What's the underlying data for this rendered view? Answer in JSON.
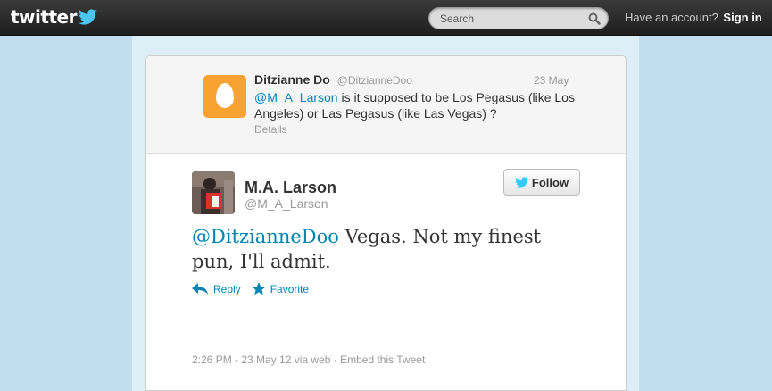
{
  "topbar": {
    "logo_text": "twitter",
    "logo_icon": "twitter-bird-icon",
    "search_placeholder": "Search",
    "account_prompt": "Have an account?",
    "signin_label": "Sign in"
  },
  "parent_tweet": {
    "author_name": "Ditzianne Do",
    "author_handle": "@DitzianneDoo",
    "date": "23 May",
    "mention": "@M_A_Larson",
    "text": " is it supposed to be Los Pegasus (like Los Angeles) or Las Pegasus (like Las Vegas) ?",
    "details_label": "Details",
    "avatar_color": "#f8a232"
  },
  "main_tweet": {
    "author_name": "M.A. Larson",
    "author_handle": "@M_A_Larson",
    "follow_label": "Follow",
    "mention": "@DitzianneDoo",
    "text": " Vegas. Not my finest pun, I'll admit.",
    "reply_label": "Reply",
    "favorite_label": "Favorite",
    "timestamp": "2:26 PM - 23 May 12",
    "via": "via web",
    "separator": "·",
    "embed_label": "Embed this Tweet"
  },
  "colors": {
    "link": "#0084b4",
    "background": "#c0deed",
    "topbar": "#2a2a2a"
  }
}
